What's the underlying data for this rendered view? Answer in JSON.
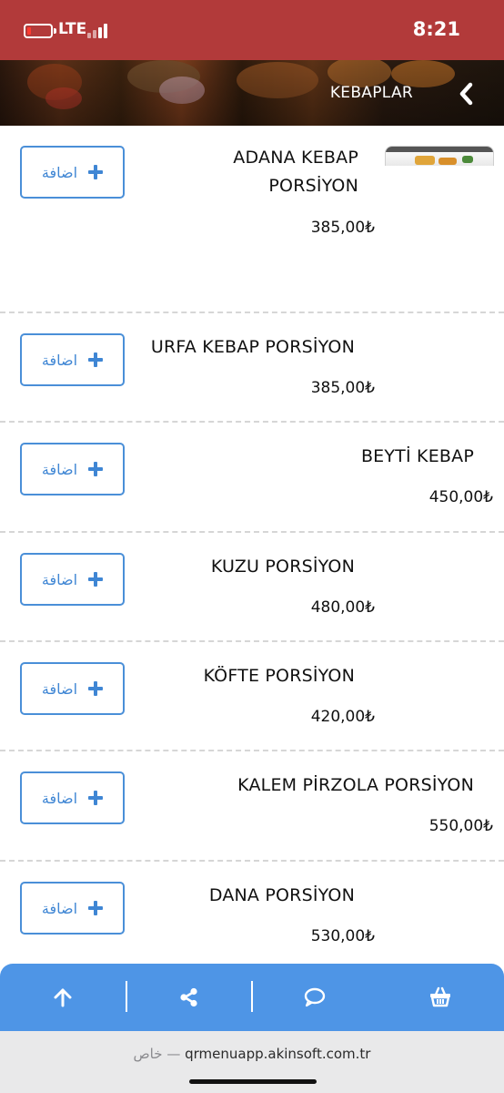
{
  "status_bar": {
    "network": "LTE",
    "time": "8:21"
  },
  "header": {
    "title": "KEBAPLAR",
    "back_icon": "chevron-left-icon"
  },
  "add_button_label": "اضافة",
  "items": [
    {
      "name": "ADANA KEBAP PORSİYON",
      "price": "385,00₺"
    },
    {
      "name": "URFA KEBAP PORSİYON",
      "price": "385,00₺"
    },
    {
      "name": "BEYTİ KEBAP",
      "price": "450,00₺"
    },
    {
      "name": "KUZU PORSİYON",
      "price": "480,00₺"
    },
    {
      "name": "KÖFTE PORSİYON",
      "price": "420,00₺"
    },
    {
      "name": "KALEM PİRZOLA PORSİYON",
      "price": "550,00₺"
    },
    {
      "name": "DANA PORSİYON",
      "price": "530,00₺"
    }
  ],
  "toolbar": {
    "icons": [
      "arrow-up-icon",
      "share-icon",
      "chat-icon",
      "basket-icon"
    ]
  },
  "url_bar": {
    "private_label": "خاص",
    "separator": "—",
    "domain": "qrmenuapp.akinsoft.com.tr"
  },
  "colors": {
    "status_bar": "#b23a3a",
    "accent": "#4a8fd8",
    "toolbar": "#4e95e6"
  }
}
